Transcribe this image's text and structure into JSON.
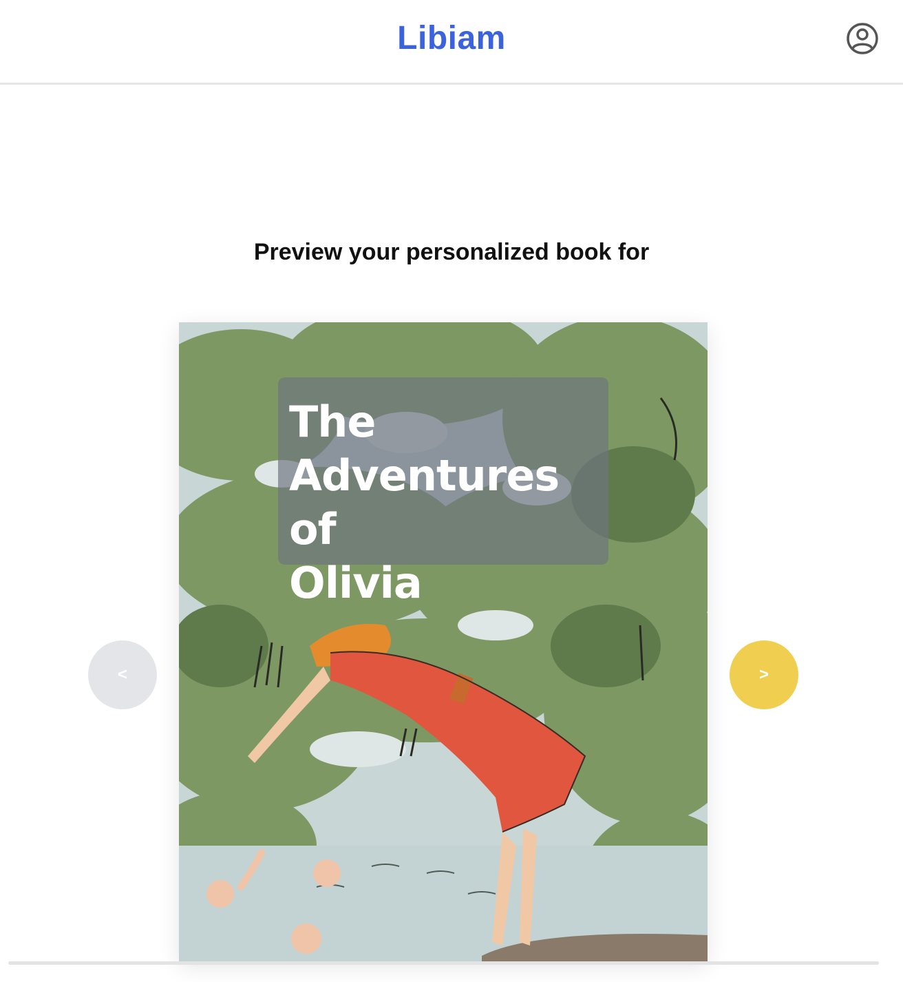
{
  "header": {
    "brand": "Libiam",
    "account_icon": "user-circle-icon"
  },
  "main": {
    "heading": "Preview your personalized book for",
    "book": {
      "title_lines": [
        "The",
        "Adventures of",
        "Olivia"
      ]
    },
    "carousel": {
      "prev_label": "<",
      "next_label": ">"
    }
  },
  "colors": {
    "brand": "#3b64dc",
    "next_button": "#f0cf50",
    "prev_button": "#e4e5e9"
  }
}
